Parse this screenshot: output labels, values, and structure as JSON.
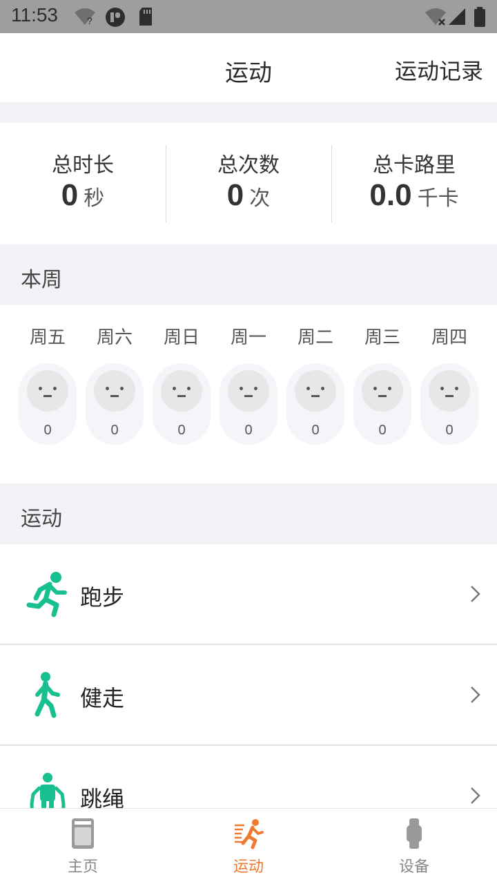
{
  "status_bar": {
    "time": "11:53",
    "icons": [
      "wifi-question-icon",
      "notification-app-icon",
      "sd-card-icon",
      "wifi-off-icon",
      "signal-icon",
      "battery-icon"
    ]
  },
  "header": {
    "title": "运动",
    "records_label": "运动记录"
  },
  "stats": [
    {
      "label": "总时长",
      "value": "0",
      "unit": "秒"
    },
    {
      "label": "总次数",
      "value": "0",
      "unit": "次"
    },
    {
      "label": "总卡路里",
      "value": "0.0",
      "unit": "千卡"
    }
  ],
  "week": {
    "title": "本周",
    "days": [
      {
        "label": "周五",
        "count": "0"
      },
      {
        "label": "周六",
        "count": "0"
      },
      {
        "label": "周日",
        "count": "0"
      },
      {
        "label": "周一",
        "count": "0"
      },
      {
        "label": "周二",
        "count": "0"
      },
      {
        "label": "周三",
        "count": "0"
      },
      {
        "label": "周四",
        "count": "0"
      }
    ]
  },
  "sports": {
    "title": "运动",
    "items": [
      {
        "label": "跑步",
        "icon": "running-icon"
      },
      {
        "label": "健走",
        "icon": "walking-icon"
      },
      {
        "label": "跳绳",
        "icon": "jump-rope-icon"
      }
    ]
  },
  "bottom_nav": {
    "items": [
      {
        "label": "主页",
        "icon": "home-device-icon",
        "active": false
      },
      {
        "label": "运动",
        "icon": "sport-running-icon",
        "active": true
      },
      {
        "label": "设备",
        "icon": "watch-icon",
        "active": false
      }
    ]
  },
  "colors": {
    "accent": "#ef7a2f",
    "sport_green": "#18c08f",
    "section_bg": "#f2f3f6",
    "status_bar_bg": "#9e9e9e"
  }
}
